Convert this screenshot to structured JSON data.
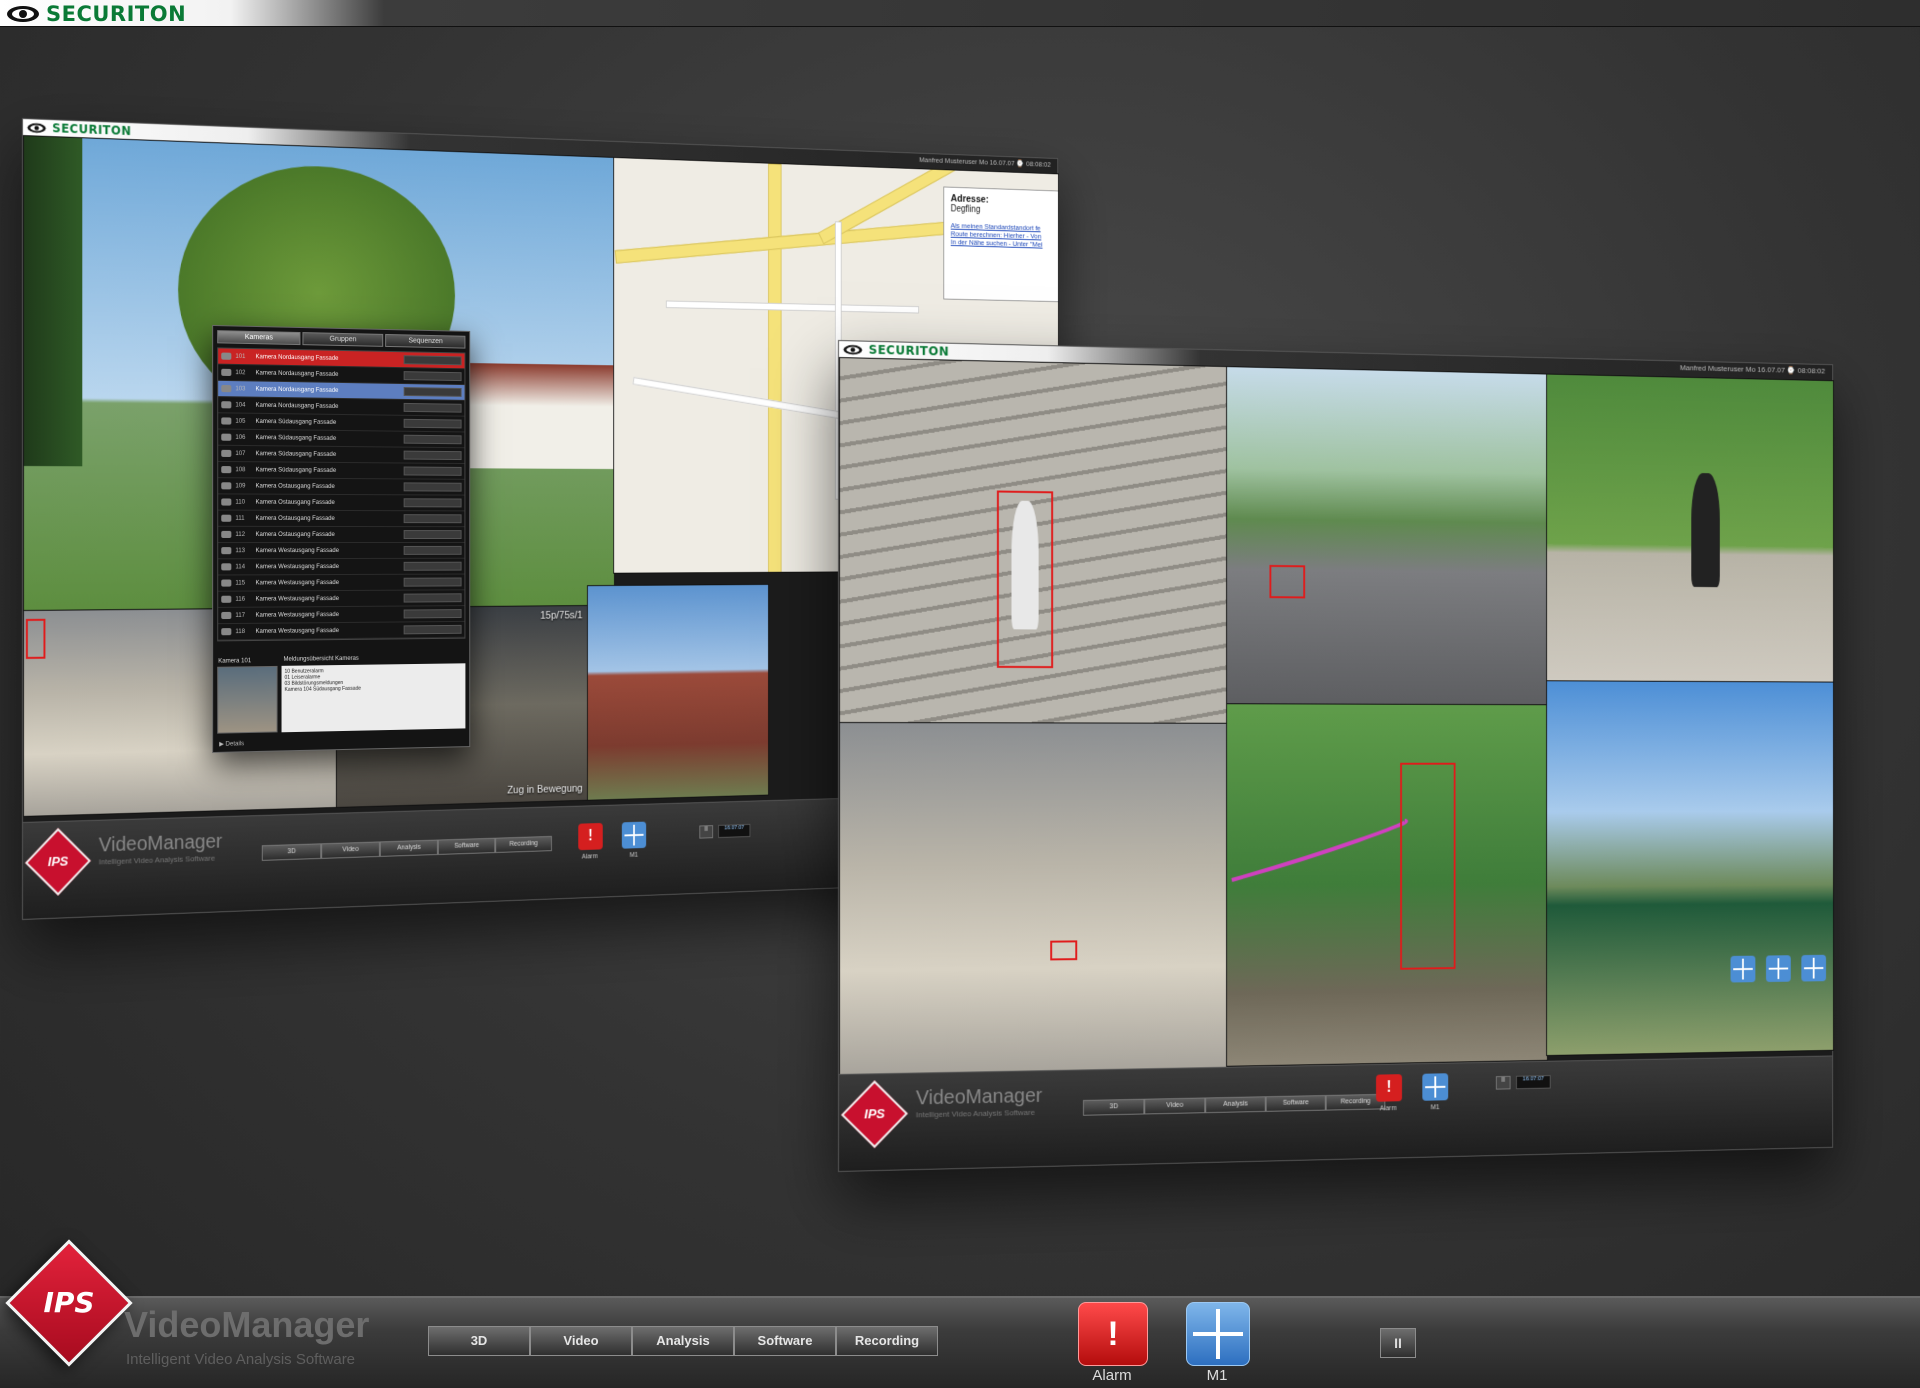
{
  "brand": {
    "name": "SECURITON"
  },
  "window1": {
    "brand": "SECURITON",
    "meta": "Manfred Musteruser    Mo 16.07.07  ⌚ 08:08:02",
    "map_popup": {
      "label": "Adresse:",
      "value": "Degfling",
      "link1": "Als meinen Standardstandort fe",
      "link2": "Route berechnen: Hierher - Von",
      "link3": "In der Nähe suchen - Unter \"Mei"
    },
    "train_overlay_top": "15p/75s/1",
    "train_overlay_bottom": "Zug in Bewegung",
    "panel": {
      "tabs": [
        "Kameras",
        "Gruppen",
        "Sequenzen"
      ],
      "rows": [
        {
          "nr": "101",
          "name": "Kamera Nordausgang Fassade",
          "state": "alarm"
        },
        {
          "nr": "102",
          "name": "Kamera Nordausgang Fassade",
          "state": ""
        },
        {
          "nr": "103",
          "name": "Kamera Nordausgang Fassade",
          "state": "sel"
        },
        {
          "nr": "104",
          "name": "Kamera Nordausgang Fassade",
          "state": ""
        },
        {
          "nr": "105",
          "name": "Kamera Südausgang Fassade",
          "state": ""
        },
        {
          "nr": "106",
          "name": "Kamera Südausgang Fassade",
          "state": ""
        },
        {
          "nr": "107",
          "name": "Kamera Südausgang Fassade",
          "state": ""
        },
        {
          "nr": "108",
          "name": "Kamera Südausgang Fassade",
          "state": ""
        },
        {
          "nr": "109",
          "name": "Kamera Ostausgang Fassade",
          "state": ""
        },
        {
          "nr": "110",
          "name": "Kamera Ostausgang Fassade",
          "state": ""
        },
        {
          "nr": "111",
          "name": "Kamera Ostausgang Fassade",
          "state": ""
        },
        {
          "nr": "112",
          "name": "Kamera Ostausgang Fassade",
          "state": ""
        },
        {
          "nr": "113",
          "name": "Kamera Westausgang Fassade",
          "state": ""
        },
        {
          "nr": "114",
          "name": "Kamera Westausgang Fassade",
          "state": ""
        },
        {
          "nr": "115",
          "name": "Kamera Westausgang Fassade",
          "state": ""
        },
        {
          "nr": "116",
          "name": "Kamera Westausgang Fassade",
          "state": ""
        },
        {
          "nr": "117",
          "name": "Kamera Westausgang Fassade",
          "state": ""
        },
        {
          "nr": "118",
          "name": "Kamera Westausgang Fassade",
          "state": ""
        }
      ],
      "thumb_label": "Kamera 101",
      "info_header": "Meldungsübersicht Kameras",
      "info_lines": [
        "10 Benutzeralarm",
        "01 Leiseralarme",
        "03 Bildstörungsmeldungen",
        "Kamera 104 Südausgang Fassade"
      ],
      "details": "▶ Details"
    },
    "bar": {
      "logo": "IPS",
      "title": "VideoManager",
      "subtitle": "Intelligent Video Analysis Software",
      "menu": [
        "3D",
        "Video",
        "Analysis",
        "Software",
        "Recording"
      ],
      "alarm_label": "Alarm",
      "m1_label": "M1",
      "clock": "16:07:07"
    }
  },
  "window2": {
    "brand": "SECURITON",
    "meta": "Manfred Musteruser    Mo 16.07.07  ⌚ 08:08:02",
    "bar": {
      "logo": "IPS",
      "title": "VideoManager",
      "subtitle": "Intelligent Video Analysis Software",
      "menu": [
        "3D",
        "Video",
        "Analysis",
        "Software",
        "Recording"
      ],
      "alarm_label": "Alarm",
      "m1_label": "M1",
      "clock": "16:07:07"
    }
  },
  "mainbar": {
    "logo": "IPS",
    "title": "VideoManager",
    "subtitle": "Intelligent Video Analysis Software",
    "menu": [
      "3D",
      "Video",
      "Analysis",
      "Software",
      "Recording"
    ],
    "alarm_icon": "!",
    "alarm_label": "Alarm",
    "m1_label": "M1",
    "pause_icon": "II"
  },
  "colors": {
    "brand_green": "#0a7a36",
    "alarm_red": "#d51f1f",
    "m1_blue": "#4c8ed4",
    "ips_red": "#c8102e"
  }
}
